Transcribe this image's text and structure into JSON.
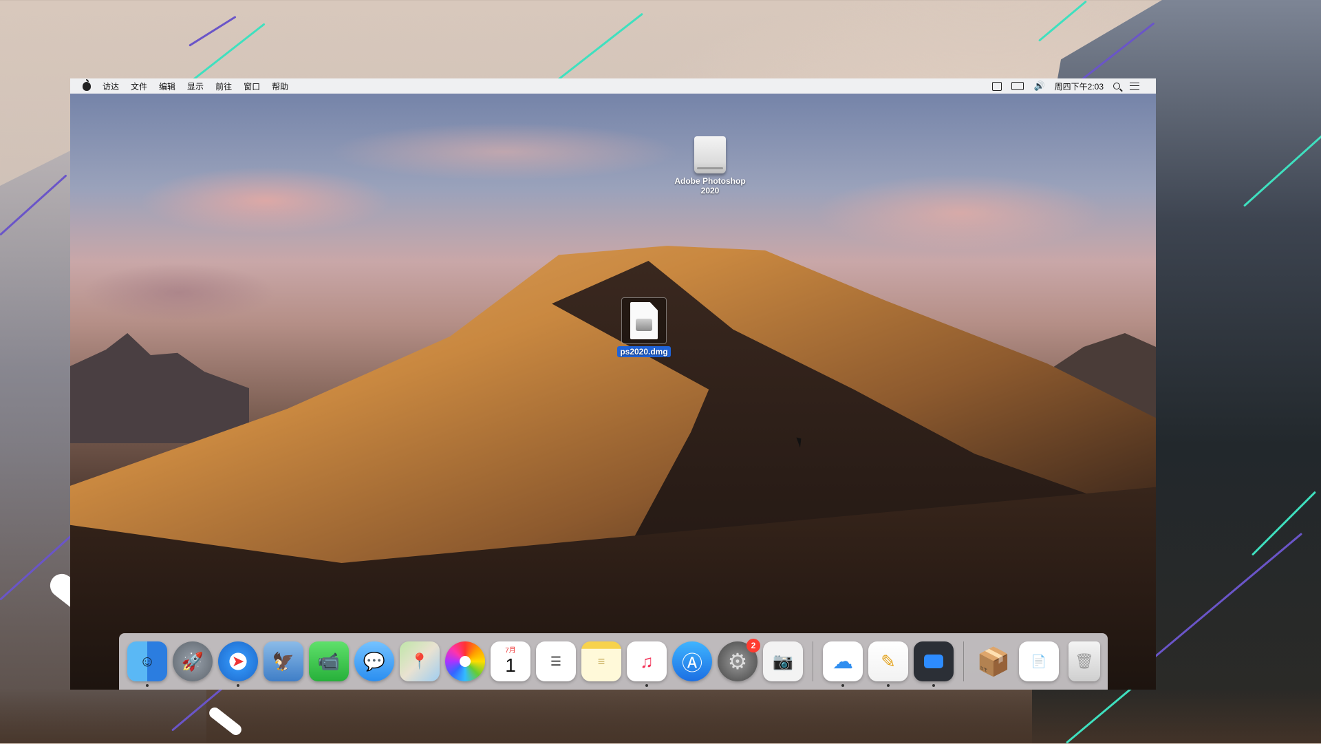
{
  "menubar": {
    "items": [
      "访达",
      "文件",
      "编辑",
      "显示",
      "前往",
      "窗口",
      "帮助"
    ],
    "clock": "周四下午2:03"
  },
  "desktop": {
    "icons": [
      {
        "label_line1": "Adobe Photoshop",
        "label_line2": "2020",
        "type": "disk-image-volume"
      },
      {
        "label": "ps2020.dmg",
        "type": "dmg-file",
        "selected": true
      }
    ]
  },
  "dock": {
    "apps": [
      {
        "name": "finder",
        "running": true
      },
      {
        "name": "launchpad",
        "running": false
      },
      {
        "name": "safari",
        "running": true
      },
      {
        "name": "mail",
        "running": false
      },
      {
        "name": "facetime",
        "running": false
      },
      {
        "name": "messages",
        "running": false
      },
      {
        "name": "maps",
        "running": false
      },
      {
        "name": "photos",
        "running": false
      },
      {
        "name": "calendar",
        "running": false,
        "month": "7月",
        "day": "1"
      },
      {
        "name": "reminders",
        "running": false
      },
      {
        "name": "notes",
        "running": false
      },
      {
        "name": "music",
        "running": true
      },
      {
        "name": "app-store",
        "running": false
      },
      {
        "name": "system-preferences",
        "running": false,
        "badge": "2"
      },
      {
        "name": "screenshot",
        "running": false
      },
      {
        "name": "baidu-netdisk",
        "running": true
      },
      {
        "name": "pages",
        "running": true
      },
      {
        "name": "zoom",
        "running": true
      },
      {
        "name": "installer",
        "running": false
      },
      {
        "name": "document-viewer",
        "running": false
      },
      {
        "name": "trash",
        "running": false
      }
    ]
  },
  "colors": {
    "selection": "#1f63d8",
    "accent_teal": "#3fe0bf",
    "accent_purple": "#6a55c8",
    "badge_red": "#ff3b30"
  }
}
